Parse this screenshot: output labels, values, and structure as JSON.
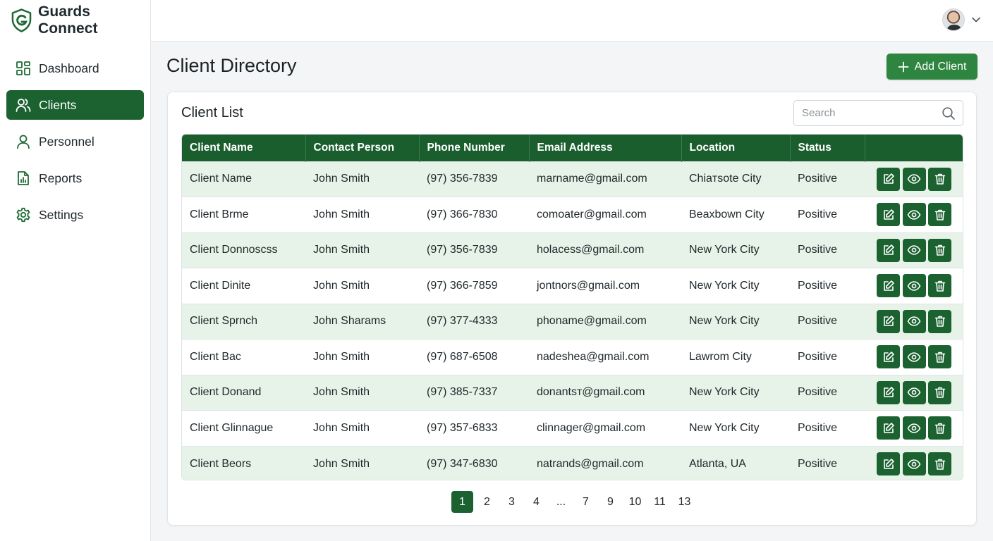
{
  "app": {
    "name": "Guards Connect"
  },
  "colors": {
    "primary": "#1b6230",
    "button": "#2e8540",
    "row_alt": "#e7f3e8"
  },
  "sidebar": {
    "items": [
      {
        "label": "Dashboard",
        "icon": "dashboard-grid-icon",
        "active": false
      },
      {
        "label": "Clients",
        "icon": "users-icon",
        "active": true
      },
      {
        "label": "Personnel",
        "icon": "person-icon",
        "active": false
      },
      {
        "label": "Reports",
        "icon": "report-icon",
        "active": false
      },
      {
        "label": "Settings",
        "icon": "gear-icon",
        "active": false
      }
    ]
  },
  "header": {
    "avatar_icon": "user-avatar",
    "menu_icon": "chevron-down-icon"
  },
  "page": {
    "title": "Client Directory",
    "add_button": "Add Client",
    "add_icon": "plus-icon"
  },
  "card": {
    "title": "Client List",
    "search_placeholder": "Search",
    "search_icon": "search-icon"
  },
  "table": {
    "columns": [
      "Client Name",
      "Contact Person",
      "Phone Number",
      "Email Address",
      "Location",
      "Status",
      ""
    ],
    "rows": [
      [
        "Client Name",
        "John Smith",
        "(97) 356-7839",
        "marname@gmail.com",
        "Chiaтsote City",
        "Positive"
      ],
      [
        "Client Brme",
        "John Smith",
        "(97) 366-7830",
        "comoater@gmail.com",
        "Beaxbown City",
        "Positive"
      ],
      [
        "Client Donnoscss",
        "John Smith",
        "(97) 356-7839",
        "holacess@gmail.com",
        "New York City",
        "Positive"
      ],
      [
        "Client Dinite",
        "John Smith",
        "(97) 366-7859",
        "jontnors@gmail.com",
        "New York City",
        "Positive"
      ],
      [
        "Client Sprnch",
        "John Sharams",
        "(97) 377-4333",
        "phoname@gmail.com",
        "New York City",
        "Positive"
      ],
      [
        "Client Bac",
        "John Smith",
        "(97) 687-6508",
        "nadeshea@gmail.com",
        "Lawrom City",
        "Positive"
      ],
      [
        "Client Donand",
        "John Smith",
        "(97) 385-7337",
        "donantsт@gmail.com",
        "New York City",
        "Positive"
      ],
      [
        "Client Glinnague",
        "John Smith",
        "(97) 357-6833",
        "clinnager@gmail.com",
        "New York City",
        "Positive"
      ],
      [
        "Client Beors",
        "John Smith",
        "(97) 347-6830",
        "natrands@gmail.com",
        "Atlanta, UA",
        "Positive"
      ]
    ],
    "row_actions": [
      "edit-icon",
      "view-eye-icon",
      "delete-trash-icon"
    ]
  },
  "pagination": {
    "pages": [
      "1",
      "2",
      "3",
      "4",
      "...",
      "7",
      "9",
      "10",
      "11",
      "13"
    ],
    "current": "1"
  }
}
